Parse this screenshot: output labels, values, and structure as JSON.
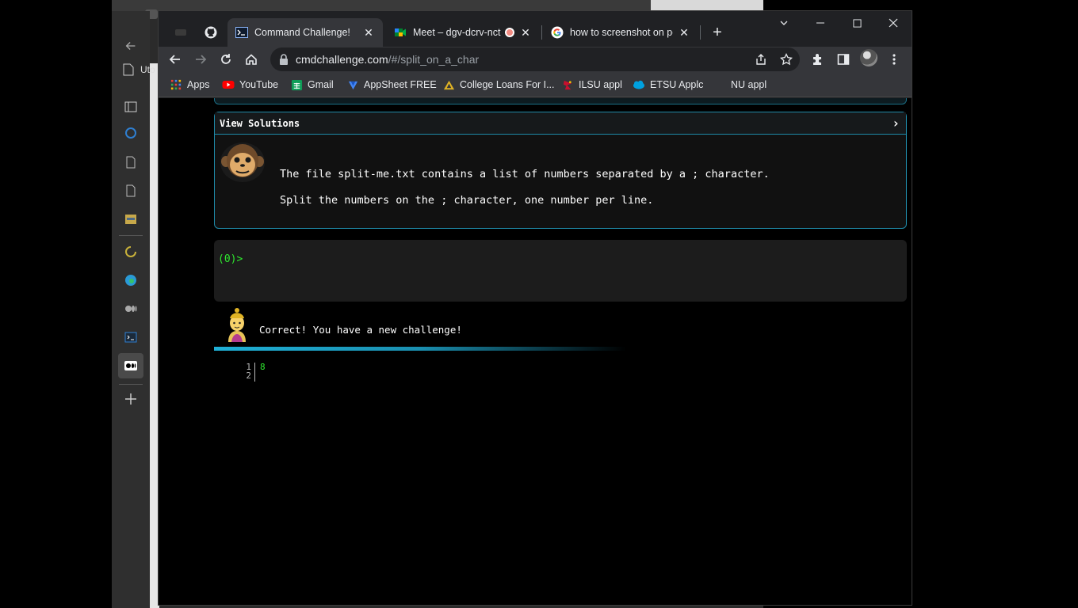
{
  "background_app": {
    "file_label": "Uto"
  },
  "browser": {
    "tabs": [
      {
        "title": "",
        "icon": "github-icon"
      },
      {
        "title": "Command Challenge!",
        "icon": "terminal-icon",
        "active": true
      },
      {
        "title": "Meet – dgv-dcrv-nct",
        "icon": "meet-icon",
        "recording": true
      },
      {
        "title": "how to screenshot on pc",
        "icon": "google-icon"
      }
    ],
    "new_tab_symbol": "+",
    "window_controls": {
      "dropdown": "⌄",
      "minimize": "—",
      "maximize": "☐",
      "close": "✕"
    },
    "url": {
      "host": "cmdchallenge.com",
      "path": "/#/split_on_a_char"
    },
    "bookmarks": [
      {
        "label": "Apps",
        "icon": "apps-grid-icon"
      },
      {
        "label": "YouTube",
        "icon": "youtube-icon"
      },
      {
        "label": "Gmail",
        "icon": "sheets-icon"
      },
      {
        "label": "AppSheet FREE",
        "icon": "appsheet-icon"
      },
      {
        "label": "College Loans For I...",
        "icon": "college-icon"
      },
      {
        "label": "ILSU appl",
        "icon": "ilsu-icon"
      },
      {
        "label": "ETSU Applc",
        "icon": "salesforce-icon"
      },
      {
        "label": "NU appl",
        "icon": "blank-icon"
      }
    ]
  },
  "challenge": {
    "header": "View Solutions",
    "chevron": "›",
    "line1": "The file split-me.txt contains a list of numbers separated by a ; character.",
    "line2": "Split the numbers on the ; character, one number per line."
  },
  "terminal": {
    "prompt": "(0)>"
  },
  "result": {
    "message": "Correct! You have a new challenge!",
    "progress": 0.6
  },
  "output": {
    "line_numbers": "1\n2",
    "content": "8"
  },
  "colors": {
    "accent": "#1f8aa8",
    "prompt_green": "#2ee82e",
    "chrome_dark": "#202124",
    "chrome_toolbar": "#35363a"
  }
}
